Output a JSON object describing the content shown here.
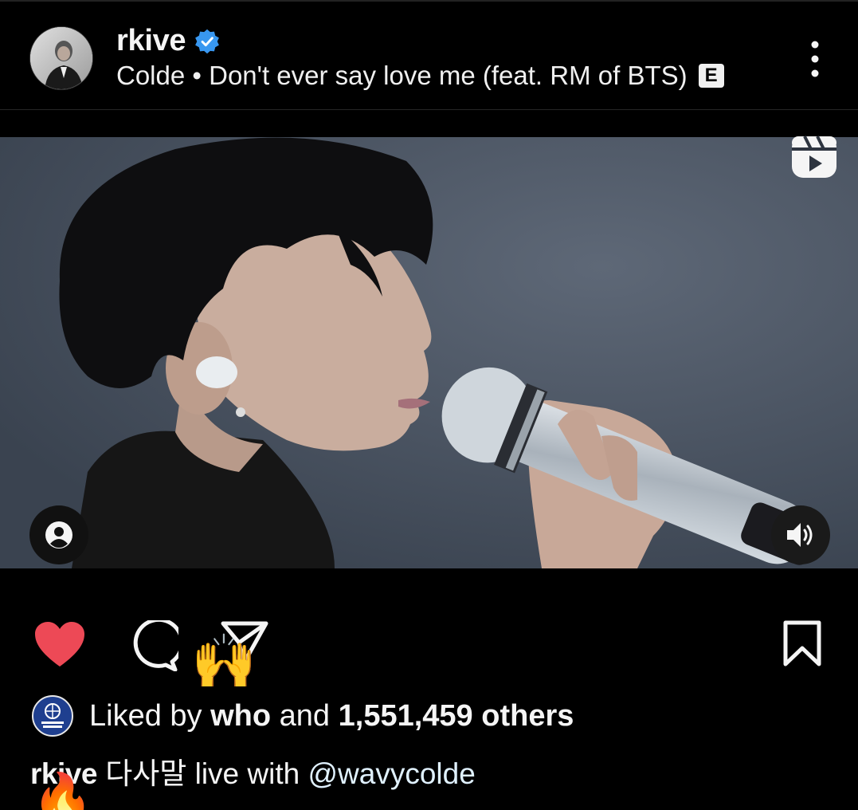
{
  "post": {
    "username": "rkive",
    "audio_track": "Colde • Don't ever say love me (feat. RM of BTS)",
    "explicit_badge": "E"
  },
  "engagement": {
    "liked_by_prefix": "Liked by",
    "liked_by_user": "who",
    "liked_by_and": "and",
    "likes_count": "1,551,459 others",
    "reaction_emoji": "🙌"
  },
  "caption": {
    "username": "rkive",
    "text": "다사말 live with",
    "mention": "@wavycolde",
    "emoji": "🔥"
  },
  "colors": {
    "background": "#000000",
    "like_red": "#ed4956",
    "verified_blue": "#3897f0"
  },
  "icons": {
    "more": "more-vertical-icon",
    "reels": "reels-icon",
    "tag": "user-tag-icon",
    "sound": "volume-icon",
    "like": "heart-filled-icon",
    "comment": "comment-icon",
    "share": "send-icon",
    "save": "bookmark-icon"
  }
}
